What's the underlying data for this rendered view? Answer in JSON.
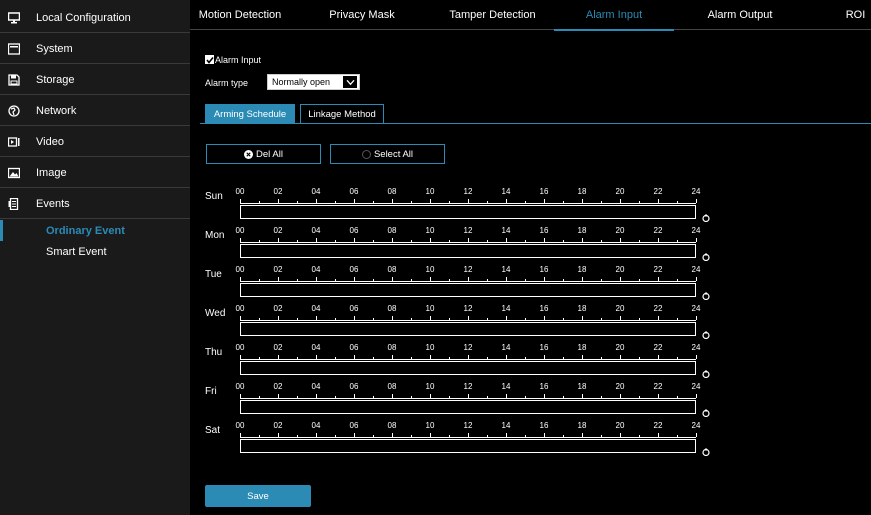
{
  "sidebar": {
    "items": [
      {
        "label": "Local Configuration",
        "icon": "monitor-icon"
      },
      {
        "label": "System",
        "icon": "system-icon"
      },
      {
        "label": "Storage",
        "icon": "storage-icon"
      },
      {
        "label": "Network",
        "icon": "network-icon"
      },
      {
        "label": "Video",
        "icon": "video-icon"
      },
      {
        "label": "Image",
        "icon": "image-icon"
      },
      {
        "label": "Events",
        "icon": "events-icon"
      }
    ],
    "sub_items": [
      {
        "label": "Ordinary Event",
        "active": true
      },
      {
        "label": "Smart Event",
        "active": false
      }
    ]
  },
  "top_tabs": [
    "Motion Detection",
    "Privacy Mask",
    "Tamper Detection",
    "Alarm Input",
    "Alarm Output",
    "ROI"
  ],
  "active_top_tab": "Alarm Input",
  "alarm_input": {
    "checkbox_label": "Alarm Input",
    "checked": true,
    "type_label": "Alarm type",
    "type_value": "Normally open"
  },
  "sub_tabs": [
    "Arming Schedule",
    "Linkage Method"
  ],
  "active_sub_tab": "Arming Schedule",
  "buttons": {
    "del_all": "Del All",
    "select_all": "Select All",
    "save": "Save"
  },
  "schedule": {
    "days": [
      "Sun",
      "Mon",
      "Tue",
      "Wed",
      "Thu",
      "Fri",
      "Sat"
    ],
    "hour_labels": [
      "00",
      "02",
      "04",
      "06",
      "08",
      "10",
      "12",
      "14",
      "16",
      "18",
      "20",
      "22",
      "24"
    ]
  },
  "colors": {
    "accent": "#2b8bb5",
    "sidebar_bg": "#1a1a1a",
    "background": "#000000"
  }
}
